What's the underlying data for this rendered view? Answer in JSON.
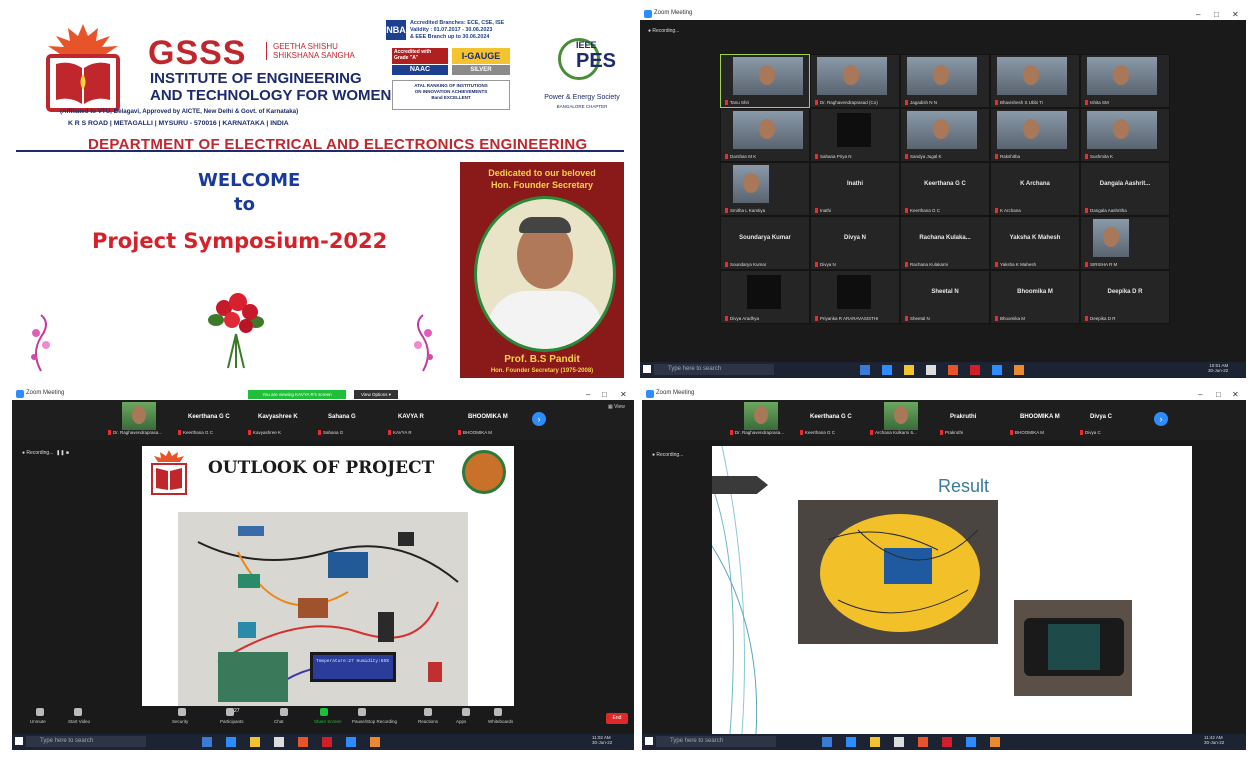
{
  "poster": {
    "gsss": "GSSS",
    "gsss_sub_1": "GEETHA SHISHU",
    "gsss_sub_2": "SHIKSHANA SANGHA",
    "inst_line1": "INSTITUTE OF ENGINEERING",
    "inst_line2": "AND TECHNOLOGY FOR WOMEN",
    "affiliation": "(Affiliated to VTU, Belagavi, Approved by AICTE, New Delhi & Govt. of Karnataka)",
    "address": "K R S ROAD | METAGALLI | MYSURU - 570016 | KARNATAKA | INDIA",
    "nba_line1": "Accredited Branches: ECE, CSE, ISE",
    "nba_line2": "Validity : 01.07.2017 - 30.06.2023",
    "nba_line3": "& EEE Branch up to 30.06.2024",
    "naac_text": "Accredited with Grade \"A\"",
    "naac_label": "NAAC",
    "igauge": "I-GAUGE",
    "igauge_sub": "SILVER",
    "atal_line1": "ATAL RANKING OF INSTITUTIONS",
    "atal_line2": "ON INNOVATION ACHIEVEMENTS",
    "atal_line3": "Band EXCELLENT",
    "ieee_top": "IEEE",
    "ieee_pes": "PES",
    "ieee_sub": "Power & Energy Society",
    "ieee_chapter": "BANGALORE CHAPTER",
    "department": "DEPARTMENT OF ELECTRICAL AND ELECTRONICS ENGINEERING",
    "welcome": "WELCOME",
    "to": "to",
    "symposium": "Project Symposium-2022",
    "founder_head_1": "Dedicated to our beloved",
    "founder_head_2": "Hon. Founder Secretary",
    "founder_name": "Prof. B.S Pandit",
    "founder_role": "Hon. Founder Secretary (1975-2008)"
  },
  "gallery_window": {
    "title": "Zoom Meeting",
    "recording": "Recording...",
    "taskbar_search": "Type here to search",
    "clock": "10:51 AM",
    "date": "30-Jun-22",
    "tiles": [
      {
        "name": "",
        "sub": "Tanu Shri",
        "photo": true
      },
      {
        "name": "",
        "sub": "Dr. Raghavendraprasad (Co)",
        "photo": true
      },
      {
        "name": "",
        "sub": "Jagadish N N",
        "photo": true
      },
      {
        "name": "",
        "sub": "Bhavishesh S Ubbi Ti",
        "photo": true
      },
      {
        "name": "",
        "sub": "Ishita SM",
        "photo": true
      },
      {
        "name": "",
        "sub": "Darshan M K",
        "photo": true
      },
      {
        "name": "",
        "sub": "Sahana Priya N",
        "photo": false
      },
      {
        "name": "",
        "sub": "Sandya Jugal K",
        "photo": true
      },
      {
        "name": "",
        "sub": "Rakshitha",
        "photo": true
      },
      {
        "name": "",
        "sub": "Sushmita K",
        "photo": true
      },
      {
        "name": "",
        "sub": "Smitha L Kamtiya",
        "photo": true
      },
      {
        "name": "Inathi",
        "sub": "Inathi",
        "photo": false
      },
      {
        "name": "Keerthana G C",
        "sub": "Keerthana G C",
        "photo": false
      },
      {
        "name": "K Archana",
        "sub": "K Archana",
        "photo": false
      },
      {
        "name": "Dangala Aashrit...",
        "sub": "Dangala Aashritha",
        "photo": false
      },
      {
        "name": "Soundarya Kumar",
        "sub": "Soundarya Kumar",
        "photo": false
      },
      {
        "name": "Divya N",
        "sub": "Divya N",
        "photo": false
      },
      {
        "name": "Rachana Kulaka...",
        "sub": "Rachana Kulakarni",
        "photo": false
      },
      {
        "name": "Yaksha K Mahesh",
        "sub": "Yaksha K Mahesh",
        "photo": false
      },
      {
        "name": "",
        "sub": "SIRISHA R M",
        "photo": true
      },
      {
        "name": "",
        "sub": "Divya Aradhya",
        "photo": false
      },
      {
        "name": "",
        "sub": "Priyanka R ARARAVASISTHI",
        "photo": false
      },
      {
        "name": "Sheetal N",
        "sub": "Sheetal N",
        "photo": false
      },
      {
        "name": "Bhoomika M",
        "sub": "Bhoomika M",
        "photo": false
      },
      {
        "name": "Deepika D R",
        "sub": "Deepika D R",
        "photo": false
      }
    ]
  },
  "share_window_left": {
    "title": "Zoom Meeting",
    "viewing_banner": "You are viewing KAVYA R's screen",
    "view_options": "View Options",
    "view_label": "View",
    "recording": "Recording...",
    "participants": [
      {
        "name": "",
        "sub": "Dr. Raghavendraprasa..."
      },
      {
        "name": "Keerthana G C",
        "sub": "Keerthana G C"
      },
      {
        "name": "Kavyashree K",
        "sub": "Kavyashree K"
      },
      {
        "name": "Sahana G",
        "sub": "Sahana G"
      },
      {
        "name": "KAVYA R",
        "sub": "KAVYA R"
      },
      {
        "name": "BHOOMIKA M",
        "sub": "BHOOMIKA M"
      }
    ],
    "slide_title": "OUTLOOK OF PROJECT",
    "lcd_text": "Temperature:27 Humidity:65%",
    "toolbar": [
      "Unmute",
      "Start Video",
      "Security",
      "Participants",
      "Chat",
      "Share Screen",
      "Pause/Stop Recording",
      "Reactions",
      "Apps",
      "Whiteboards"
    ],
    "end": "End",
    "participant_count": "27",
    "taskbar_search": "Type here to search",
    "clock": "11:02 AM",
    "date": "30-Jun-22"
  },
  "share_window_right": {
    "title": "Zoom Meeting",
    "recording": "Recording...",
    "participants": [
      {
        "name": "",
        "sub": "Dr. Raghavendraprasa..."
      },
      {
        "name": "Keerthana G C",
        "sub": "Keerthana G C"
      },
      {
        "name": "",
        "sub": "Archana Kulkarni 6..."
      },
      {
        "name": "Prakruthi",
        "sub": "Prakruthi"
      },
      {
        "name": "BHOOMIKA M",
        "sub": "BHOOMIKA M"
      },
      {
        "name": "Divya C",
        "sub": "Divya C"
      }
    ],
    "slide_title": "Result",
    "taskbar_search": "Type here to search",
    "clock": "11:42 AM",
    "date": "30-Jun-22"
  },
  "colors": {
    "brand_red": "#c0272d",
    "brand_navy": "#1d2a6b",
    "zoom_green": "#1fbf3a",
    "end_red": "#e02828",
    "zoom_blue": "#2d8cff"
  }
}
